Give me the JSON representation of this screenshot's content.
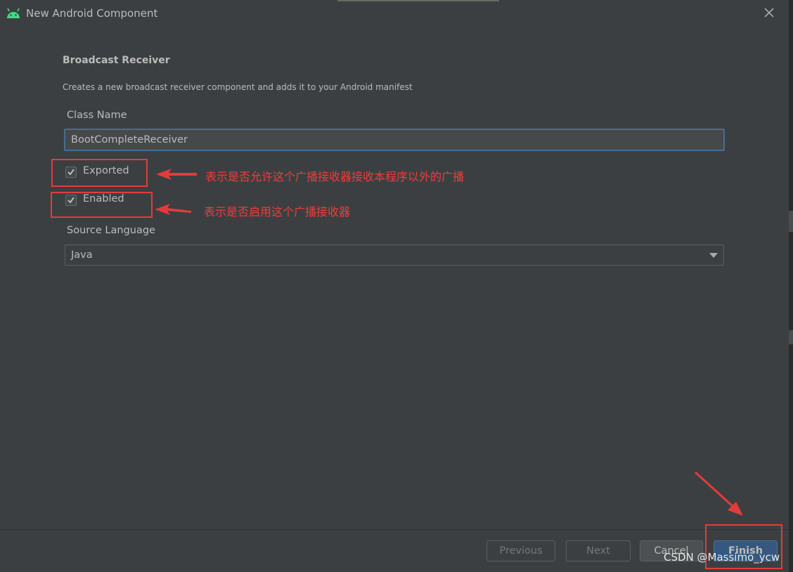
{
  "window": {
    "title": "New Android Component",
    "icon": "android-icon",
    "close_icon": "close-icon"
  },
  "header": {
    "title": "Broadcast Receiver",
    "description": "Creates a new broadcast receiver component and adds it to your Android manifest"
  },
  "form": {
    "class_name_label": "Class Name",
    "class_name_value": "BootCompleteReceiver",
    "exported": {
      "label": "Exported",
      "checked": true
    },
    "enabled": {
      "label": "Enabled",
      "checked": true
    },
    "source_language_label": "Source Language",
    "source_language_value": "Java",
    "source_language_options": [
      "Java"
    ]
  },
  "annotations": {
    "exported_note": "表示是否允许这个广播接收器接收本程序以外的广播",
    "enabled_note": "表示是否启用这个广播接收器",
    "color": "#e33b3b"
  },
  "footer": {
    "previous_label": "Previous",
    "next_label": "Next",
    "cancel_label": "Cancel",
    "finish_label": "Finish"
  },
  "watermark": "CSDN @Massimo_ycw",
  "colors": {
    "background": "#3c3f41",
    "input_focus_border": "#466d94",
    "primary_button": "#365880"
  }
}
